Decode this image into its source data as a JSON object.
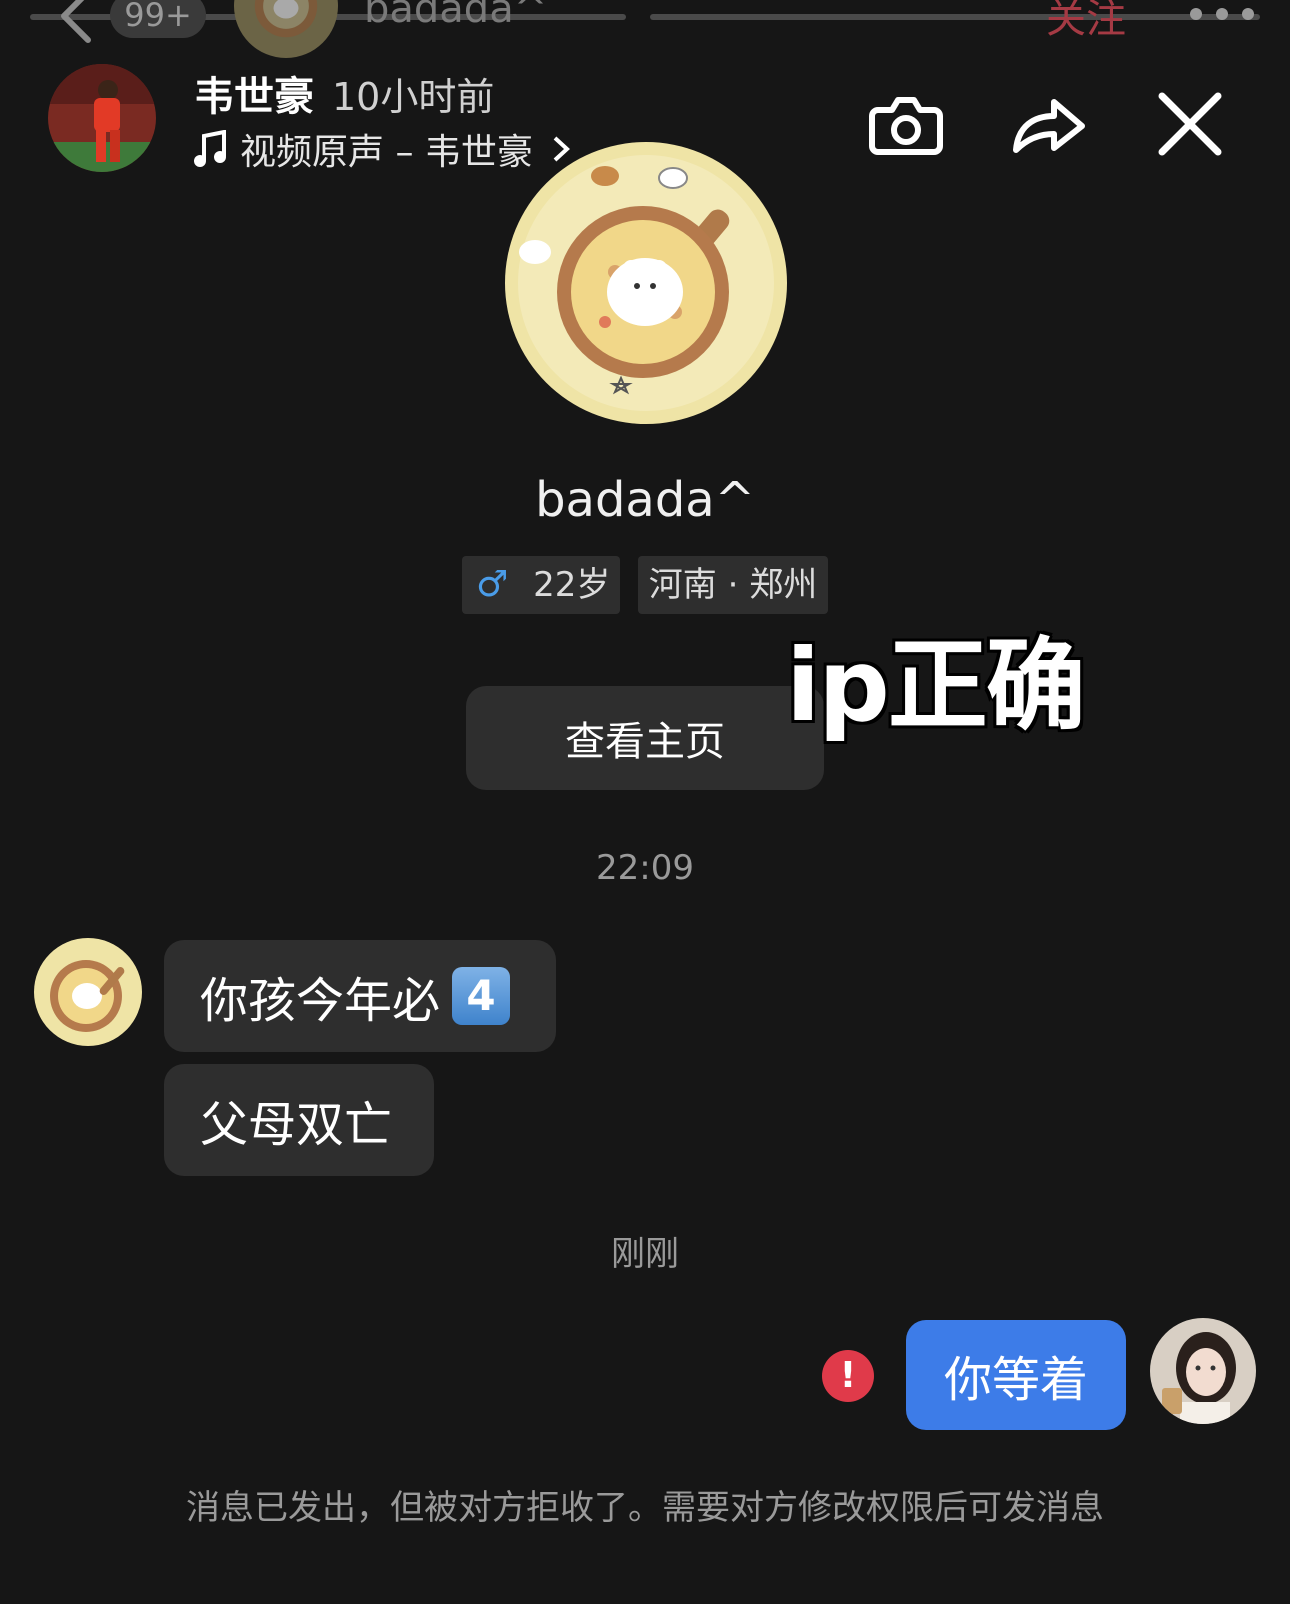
{
  "top_header": {
    "badge": "99+",
    "name": "badada^",
    "follow_label": "关注"
  },
  "video_overlay": {
    "author": "韦世豪",
    "posted": "10小时前",
    "music": "视频原声 – 韦世豪",
    "icons": [
      "camera-icon",
      "share-icon",
      "close-icon"
    ]
  },
  "profile": {
    "name": "badada^",
    "gender_symbol": "♂",
    "age": "22岁",
    "location": "河南 · 郑州",
    "view_home_label": "查看主页"
  },
  "caption_overlay": "ip正确",
  "messages": {
    "time_1": "22:09",
    "incoming": [
      {
        "text": "你孩今年必",
        "emoji": "4"
      },
      {
        "text": "父母双亡"
      }
    ],
    "time_2": "刚刚",
    "outgoing": {
      "text": "你等着",
      "status": "!"
    },
    "notice": "消息已发出，但被对方拒收了。需要对方修改权限后可发消息"
  },
  "colors": {
    "background": "#161616",
    "bubble_in": "#2e2e2e",
    "bubble_out": "#3d7ce8",
    "error": "#e03a4a",
    "follow": "#a53a44"
  }
}
